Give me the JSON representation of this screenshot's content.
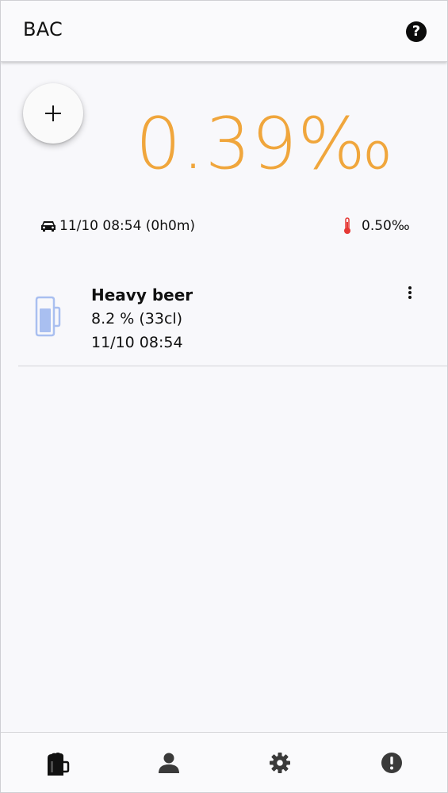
{
  "appbar": {
    "title": "BAC",
    "help_icon": "help-circle-icon"
  },
  "fab": {
    "icon": "plus-icon"
  },
  "bac": {
    "value": "0.39‰",
    "color": "#f0a63c"
  },
  "sober": {
    "icon": "car-icon",
    "text": "11/10 08:54 (0h0m)"
  },
  "peak": {
    "icon": "thermometer-icon",
    "text": "0.50‰",
    "icon_color": "#e53935"
  },
  "drinks": [
    {
      "icon": "beer-mug-icon",
      "name": "Heavy beer",
      "detail": "8.2 % (33cl)",
      "time": "11/10 08:54",
      "menu_icon": "more-vertical-icon"
    }
  ],
  "bottom_nav": [
    {
      "icon": "beer-icon",
      "label": "drinks"
    },
    {
      "icon": "person-icon",
      "label": "profile"
    },
    {
      "icon": "gear-icon",
      "label": "settings"
    },
    {
      "icon": "alert-icon",
      "label": "about"
    }
  ]
}
